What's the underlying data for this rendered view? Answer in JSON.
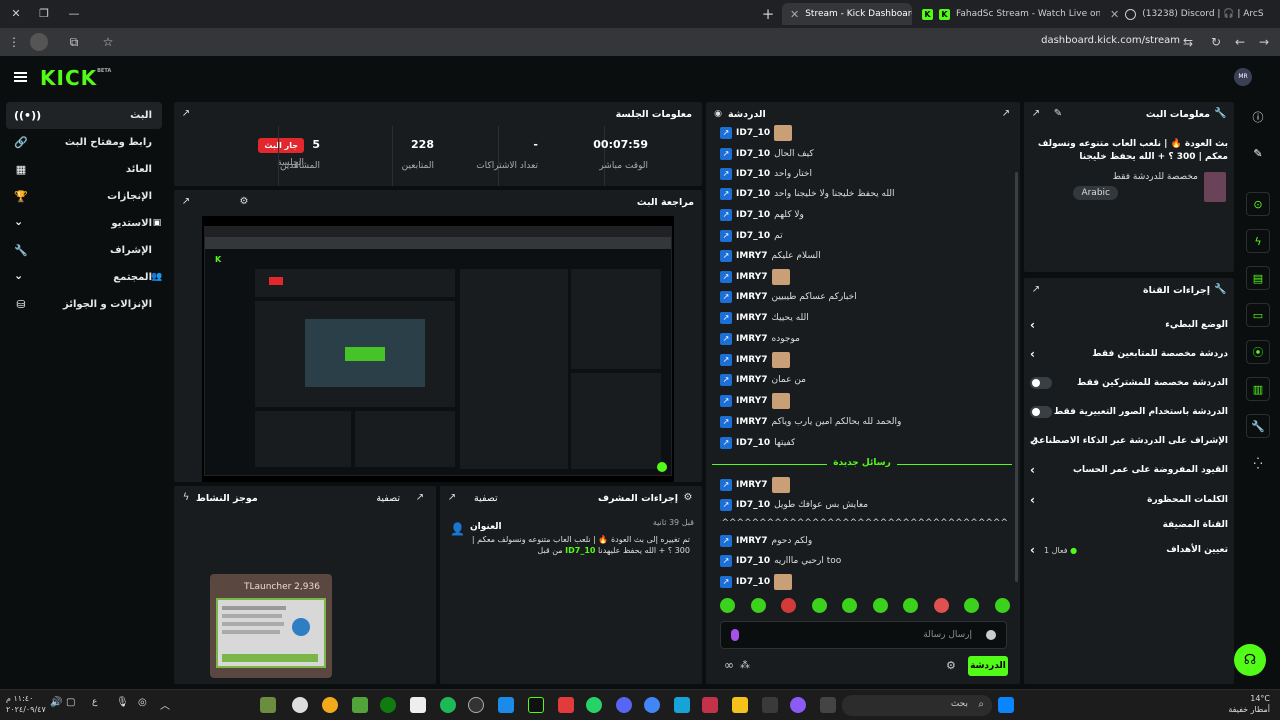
{
  "browser": {
    "tabs": [
      {
        "title": "Stream - Kick Dashboard",
        "active": true
      },
      {
        "title": "FahadSc Stream - Watch Live on",
        "active": false
      },
      {
        "title": "(13238) Discord | 🎧 | ArcS",
        "active": false
      }
    ],
    "url": "dashboard.kick.com/stream"
  },
  "header": {
    "logo": "KICK",
    "logo_tag": "BETA",
    "avatar_text": "MR"
  },
  "nav": {
    "items": [
      {
        "label": "البث",
        "icon": "broadcast-icon"
      },
      {
        "label": "رابط ومفتاح البث",
        "icon": "link-icon"
      },
      {
        "label": "العائد",
        "icon": "revenue-icon"
      },
      {
        "label": "الإنجازات",
        "icon": "trophy-icon"
      },
      {
        "label": "الاستديو",
        "icon": "studio-icon"
      },
      {
        "label": "الإشراف",
        "icon": "wrench-icon"
      },
      {
        "label": "المجتمع",
        "icon": "community-icon"
      },
      {
        "label": "الإنزالات و الجوائز",
        "icon": "drops-icon"
      }
    ]
  },
  "session": {
    "title": "معلومات الجلسة",
    "live_badge": "جار البث",
    "stats": [
      {
        "value": "",
        "label": "الجلسة"
      },
      {
        "value": "5",
        "label": "المشاهدين"
      },
      {
        "value": "228",
        "label": "المتابعين"
      },
      {
        "value": "-",
        "label": "تعداد الاشتراكات"
      },
      {
        "value": "00:07:59",
        "label": "الوقت مباشر"
      }
    ]
  },
  "preview": {
    "title": "مراجعة البث"
  },
  "activity": {
    "title": "موجز النشاط",
    "filter": "تصفية",
    "card_title": "TLauncher 2,936"
  },
  "modactions": {
    "title": "إجراءات المشرف",
    "filter": "تصفية",
    "time": "قبل 39 ثانية",
    "heading": "العنوان",
    "change_text": "تم تغييره إلى بث العودة 🔥 | نلعب العاب متنوعه ونسولف معكم | 300 ؟ + الله يحفظ عليهدنا",
    "by": "من قبل",
    "by_user": "ID7_10"
  },
  "chat": {
    "title": "الدردشة",
    "new_messages": "رسائل جديدة",
    "placeholder": "إرسال رسالة",
    "send_label": "الدردشة",
    "messages": [
      {
        "user": "ID7_10",
        "text": "",
        "emote": true
      },
      {
        "user": "ID7_10",
        "text": "كيف الحال"
      },
      {
        "user": "ID7_10",
        "text": "اختار واحد"
      },
      {
        "user": "ID7_10",
        "text": "الله يحفظ خليجنا ولا خليجنا واحد"
      },
      {
        "user": "ID7_10",
        "text": "ولا كلهم"
      },
      {
        "user": "ID7_10",
        "text": "تم"
      },
      {
        "user": "IMRY7",
        "text": "السلام عليكم"
      },
      {
        "user": "IMRY7",
        "text": "",
        "emote": true
      },
      {
        "user": "IMRY7",
        "text": "اخباركم عساكم طيبيين"
      },
      {
        "user": "IMRY7",
        "text": "الله يحييك"
      },
      {
        "user": "IMRY7",
        "text": "موجوده"
      },
      {
        "user": "IMRY7",
        "text": "",
        "emote": true
      },
      {
        "user": "IMRY7",
        "text": "من عمان"
      },
      {
        "user": "IMRY7",
        "text": "",
        "emote": true
      },
      {
        "user": "IMRY7",
        "text": "والحمد لله بحالكم امين يارب وياكم"
      },
      {
        "user": "ID7_10",
        "text": "كفيتها"
      },
      {
        "user": "IMRY7",
        "text": "",
        "emote": true
      },
      {
        "user": "ID7_10",
        "text": "معايش بس عوافك طويل"
      },
      {
        "user": "",
        "text": "^^^^^^^^^^^^^^^^^^^^^^^^^^^^^^^^^^^^^^^^^^^^^^^^^^^"
      },
      {
        "user": "IMRY7",
        "text": "ولكم دحوم"
      },
      {
        "user": "ID7_10",
        "text": "too ارحبي ماااريه"
      },
      {
        "user": "ID7_10",
        "text": "",
        "emote": true
      }
    ]
  },
  "stream_info": {
    "title": "معلومات البث",
    "stream_title": "بث العودة 🔥 | نلعب العاب متنوعه ونسولف معكم | 300 ؟ + الله يحفظ خليجنا",
    "category": "مخصصة للدردشة فقط",
    "language": "Arabic"
  },
  "channel_actions": {
    "title": "إجراءات القناة",
    "rows": [
      {
        "label": "الوضع البطيء",
        "kind": "chevron"
      },
      {
        "label": "دردشة مخصصة للمتابعين فقط",
        "kind": "chevron"
      },
      {
        "label": "الدردشة مخصصة للمشتركين فقط",
        "kind": "toggle"
      },
      {
        "label": "الدردشة باستخدام الصور التعبيرية فقط",
        "kind": "toggle"
      },
      {
        "label": "الإشراف على الدردشة عبر الذكاء الاصطناعي",
        "kind": "external"
      },
      {
        "label": "القيود المفروضة على عمر الحساب",
        "kind": "chevron"
      },
      {
        "label": "الكلمات المحظورة",
        "kind": "chevron"
      }
    ],
    "section_label": "القناة المضيفة",
    "goals_label": "تعيين الأهداف",
    "goals_value": "فعال 1"
  },
  "taskbar": {
    "search": "بحث",
    "weather_temp": "14°C",
    "weather_desc": "أمطار خفيفة",
    "time": "١١:٤٠ م",
    "date": "٢٠٢٤/٠٩/٤٧"
  },
  "colors": {
    "accent": "#53fc18",
    "live": "#e2282d",
    "panel": "#191c1e",
    "bg": "#0b0e0f"
  }
}
